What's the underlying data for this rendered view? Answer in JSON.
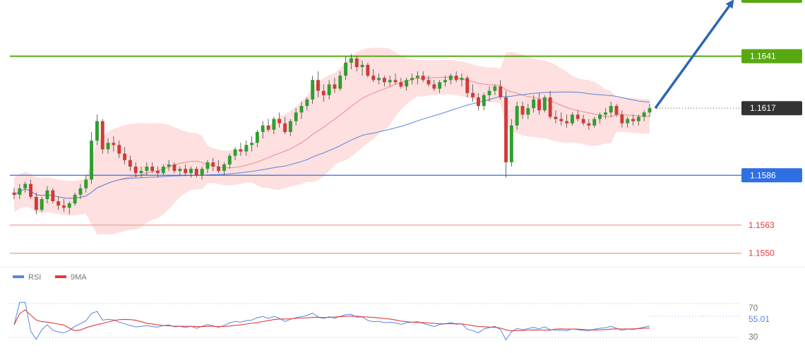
{
  "chart_data": {
    "type": "candlestick",
    "price_axis": {
      "min": 1.1545,
      "max": 1.1665
    },
    "levels": [
      {
        "name": "resistance",
        "value": 1.1641,
        "label": "1.1641",
        "color": "#58a812",
        "style": "badge"
      },
      {
        "name": "current",
        "value": 1.1617,
        "label": "1.1617",
        "color": "#333333",
        "style": "badge-dotted"
      },
      {
        "name": "support",
        "value": 1.1586,
        "label": "1.1586",
        "color": "#2f6fe4",
        "style": "badge"
      },
      {
        "name": "target-1",
        "value": 1.1563,
        "label": "1.1563",
        "color": "#e23b3b",
        "style": "text"
      },
      {
        "name": "target-2",
        "value": 1.155,
        "label": "1.1550",
        "color": "#e23b3b",
        "style": "text"
      }
    ],
    "candles": [
      [
        1.1578,
        1.158,
        1.1575,
        1.1577
      ],
      [
        1.1577,
        1.1582,
        1.1575,
        1.158
      ],
      [
        1.158,
        1.1583,
        1.1578,
        1.1582
      ],
      [
        1.1582,
        1.1584,
        1.1575,
        1.1576
      ],
      [
        1.1576,
        1.1578,
        1.1568,
        1.157
      ],
      [
        1.157,
        1.1576,
        1.1569,
        1.1575
      ],
      [
        1.1575,
        1.1581,
        1.1573,
        1.1579
      ],
      [
        1.1579,
        1.158,
        1.1573,
        1.1574
      ],
      [
        1.1574,
        1.1576,
        1.157,
        1.1572
      ],
      [
        1.1572,
        1.1575,
        1.1569,
        1.1571
      ],
      [
        1.1571,
        1.1574,
        1.1568,
        1.1573
      ],
      [
        1.1573,
        1.1578,
        1.1572,
        1.1577
      ],
      [
        1.1577,
        1.1582,
        1.1575,
        1.158
      ],
      [
        1.158,
        1.1586,
        1.1578,
        1.1584
      ],
      [
        1.1584,
        1.1606,
        1.1582,
        1.1602
      ],
      [
        1.1602,
        1.1614,
        1.16,
        1.1611
      ],
      [
        1.1611,
        1.1612,
        1.1596,
        1.1598
      ],
      [
        1.1598,
        1.1603,
        1.1596,
        1.1601
      ],
      [
        1.1601,
        1.1604,
        1.1597,
        1.16
      ],
      [
        1.16,
        1.1602,
        1.1594,
        1.1596
      ],
      [
        1.1596,
        1.1599,
        1.1591,
        1.1593
      ],
      [
        1.1593,
        1.1595,
        1.1588,
        1.159
      ],
      [
        1.159,
        1.1592,
        1.1585,
        1.1587
      ],
      [
        1.1587,
        1.159,
        1.1585,
        1.1588
      ],
      [
        1.1588,
        1.1592,
        1.1586,
        1.159
      ],
      [
        1.159,
        1.1592,
        1.1587,
        1.1588
      ],
      [
        1.1588,
        1.159,
        1.1585,
        1.1587
      ],
      [
        1.1587,
        1.1591,
        1.1586,
        1.159
      ],
      [
        1.159,
        1.1593,
        1.1588,
        1.1591
      ],
      [
        1.1591,
        1.1592,
        1.1587,
        1.1588
      ],
      [
        1.1588,
        1.159,
        1.1586,
        1.1589
      ],
      [
        1.1589,
        1.1591,
        1.1586,
        1.1587
      ],
      [
        1.1587,
        1.159,
        1.1585,
        1.1589
      ],
      [
        1.1589,
        1.159,
        1.1585,
        1.1586
      ],
      [
        1.1586,
        1.159,
        1.1584,
        1.1589
      ],
      [
        1.1589,
        1.1593,
        1.1587,
        1.1592
      ],
      [
        1.1592,
        1.1594,
        1.1588,
        1.159
      ],
      [
        1.159,
        1.1593,
        1.1587,
        1.1588
      ],
      [
        1.1588,
        1.1592,
        1.1586,
        1.1591
      ],
      [
        1.1591,
        1.1596,
        1.1589,
        1.1595
      ],
      [
        1.1595,
        1.1599,
        1.1593,
        1.1598
      ],
      [
        1.1598,
        1.1601,
        1.1595,
        1.1597
      ],
      [
        1.1597,
        1.1602,
        1.1595,
        1.16
      ],
      [
        1.16,
        1.1604,
        1.1597,
        1.1601
      ],
      [
        1.1601,
        1.1607,
        1.1599,
        1.1606
      ],
      [
        1.1606,
        1.1611,
        1.1603,
        1.1609
      ],
      [
        1.1609,
        1.1612,
        1.1606,
        1.1607
      ],
      [
        1.1607,
        1.1613,
        1.1605,
        1.1612
      ],
      [
        1.1612,
        1.1615,
        1.1608,
        1.161
      ],
      [
        1.161,
        1.1613,
        1.1605,
        1.1606
      ],
      [
        1.1606,
        1.1612,
        1.1604,
        1.1611
      ],
      [
        1.1611,
        1.1617,
        1.1609,
        1.1615
      ],
      [
        1.1615,
        1.162,
        1.1612,
        1.1618
      ],
      [
        1.1618,
        1.1622,
        1.1616,
        1.1621
      ],
      [
        1.1621,
        1.1632,
        1.1619,
        1.163
      ],
      [
        1.163,
        1.1634,
        1.1622,
        1.1625
      ],
      [
        1.1625,
        1.1628,
        1.162,
        1.1623
      ],
      [
        1.1623,
        1.163,
        1.1621,
        1.1628
      ],
      [
        1.1628,
        1.1631,
        1.1624,
        1.1626
      ],
      [
        1.1626,
        1.1634,
        1.1625,
        1.1632
      ],
      [
        1.1632,
        1.1641,
        1.163,
        1.1638
      ],
      [
        1.1638,
        1.1642,
        1.1635,
        1.164
      ],
      [
        1.164,
        1.1641,
        1.1634,
        1.1636
      ],
      [
        1.1636,
        1.1639,
        1.1632,
        1.1637
      ],
      [
        1.1637,
        1.1638,
        1.1631,
        1.1632
      ],
      [
        1.1632,
        1.1635,
        1.1629,
        1.163
      ],
      [
        1.163,
        1.1633,
        1.1628,
        1.1631
      ],
      [
        1.1631,
        1.1632,
        1.1627,
        1.1629
      ],
      [
        1.1629,
        1.1632,
        1.1627,
        1.163
      ],
      [
        1.163,
        1.1633,
        1.1628,
        1.1629
      ],
      [
        1.1629,
        1.1631,
        1.1626,
        1.1627
      ],
      [
        1.1627,
        1.1631,
        1.1625,
        1.163
      ],
      [
        1.163,
        1.1633,
        1.1628,
        1.1631
      ],
      [
        1.1631,
        1.1634,
        1.1628,
        1.1632
      ],
      [
        1.1632,
        1.1634,
        1.1629,
        1.163
      ],
      [
        1.163,
        1.1632,
        1.1627,
        1.1628
      ],
      [
        1.1628,
        1.163,
        1.1625,
        1.1626
      ],
      [
        1.1626,
        1.163,
        1.1624,
        1.1629
      ],
      [
        1.1629,
        1.1632,
        1.1627,
        1.163
      ],
      [
        1.163,
        1.1633,
        1.1628,
        1.1632
      ],
      [
        1.1632,
        1.1634,
        1.1629,
        1.163
      ],
      [
        1.163,
        1.1633,
        1.1627,
        1.1631
      ],
      [
        1.1631,
        1.1632,
        1.1622,
        1.1624
      ],
      [
        1.1624,
        1.1628,
        1.162,
        1.1622
      ],
      [
        1.1622,
        1.1624,
        1.1616,
        1.1618
      ],
      [
        1.1618,
        1.1624,
        1.1616,
        1.1623
      ],
      [
        1.1623,
        1.1627,
        1.162,
        1.1625
      ],
      [
        1.1625,
        1.1628,
        1.1623,
        1.1627
      ],
      [
        1.1627,
        1.163,
        1.1621,
        1.1622
      ],
      [
        1.1622,
        1.1625,
        1.1585,
        1.1592
      ],
      [
        1.1592,
        1.1612,
        1.159,
        1.1609
      ],
      [
        1.1609,
        1.162,
        1.1607,
        1.1618
      ],
      [
        1.1618,
        1.162,
        1.1612,
        1.1614
      ],
      [
        1.1614,
        1.1619,
        1.1612,
        1.1617
      ],
      [
        1.1617,
        1.1623,
        1.1615,
        1.1621
      ],
      [
        1.1621,
        1.1624,
        1.1614,
        1.1616
      ],
      [
        1.1616,
        1.1623,
        1.1615,
        1.1622
      ],
      [
        1.1622,
        1.1625,
        1.1612,
        1.1613
      ],
      [
        1.1613,
        1.1616,
        1.161,
        1.1612
      ],
      [
        1.1612,
        1.1615,
        1.1609,
        1.1611
      ],
      [
        1.1611,
        1.1614,
        1.1608,
        1.161
      ],
      [
        1.161,
        1.1615,
        1.1609,
        1.1614
      ],
      [
        1.1614,
        1.1616,
        1.1611,
        1.1612
      ],
      [
        1.1612,
        1.1614,
        1.1609,
        1.161
      ],
      [
        1.161,
        1.1612,
        1.1607,
        1.1609
      ],
      [
        1.1609,
        1.1613,
        1.1608,
        1.1612
      ],
      [
        1.1612,
        1.1615,
        1.161,
        1.1614
      ],
      [
        1.1614,
        1.1617,
        1.1612,
        1.1615
      ],
      [
        1.1615,
        1.162,
        1.1613,
        1.1618
      ],
      [
        1.1618,
        1.1619,
        1.1613,
        1.1614
      ],
      [
        1.1614,
        1.1616,
        1.1608,
        1.161
      ],
      [
        1.161,
        1.1613,
        1.1608,
        1.1612
      ],
      [
        1.1612,
        1.1614,
        1.1609,
        1.1611
      ],
      [
        1.1611,
        1.1614,
        1.1609,
        1.1613
      ],
      [
        1.1613,
        1.1616,
        1.1611,
        1.1615
      ],
      [
        1.1615,
        1.1619,
        1.1613,
        1.1617
      ]
    ],
    "indicator": {
      "legend": [
        {
          "name": "RSI",
          "color": "#5b84e0"
        },
        {
          "name": "9MA",
          "color": "#e23b3b"
        }
      ],
      "levels": [
        {
          "value": 70,
          "label": "70"
        },
        {
          "value": 30,
          "label": "30"
        }
      ],
      "current": {
        "value": 55.01,
        "label": "55.01"
      },
      "range": [
        15,
        95
      ]
    }
  }
}
